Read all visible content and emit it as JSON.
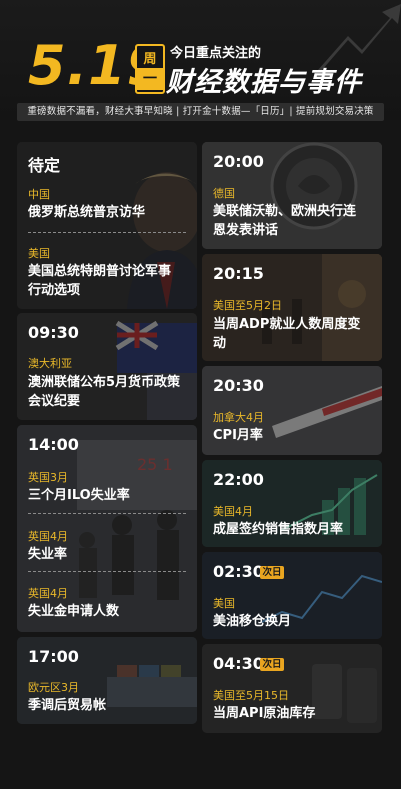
{
  "header": {
    "date": "5.19",
    "weekday_top": "周",
    "weekday_bottom": "一",
    "subtitle": "今日重点关注的",
    "title": "财经数据与事件",
    "tagline": "重磅数据不漏看，财经大事早知晓 | 打开金十数据—「日历」| 提前规划交易决策"
  },
  "left_column": [
    {
      "time": "待定",
      "items": [
        {
          "region": "中国",
          "event": [
            "俄罗斯总统普京访华"
          ]
        },
        {
          "region": "美国",
          "event": [
            "美国总统特朗普讨论军事",
            "行动选项"
          ]
        }
      ]
    },
    {
      "time": "09:30",
      "items": [
        {
          "region": "澳大利亚",
          "event": [
            "澳洲联储公布5月货币政策",
            "会议纪要"
          ]
        }
      ]
    },
    {
      "time": "14:00",
      "items": [
        {
          "region": "英国3月",
          "event": [
            "三个月ILO失业率"
          ]
        },
        {
          "region": "英国4月",
          "event": [
            "失业率"
          ]
        },
        {
          "region": "英国4月",
          "event": [
            "失业金申请人数"
          ]
        }
      ]
    },
    {
      "time": "17:00",
      "items": [
        {
          "region": "欧元区3月",
          "event": [
            "季调后贸易帐"
          ]
        }
      ]
    }
  ],
  "right_column": [
    {
      "time": "20:00",
      "region": "德国",
      "event": [
        "美联储沃勒、欧洲央行连",
        "恩发表讲话"
      ]
    },
    {
      "time": "20:15",
      "region": "美国至5月2日",
      "event": [
        "当周ADP就业人数周度变",
        "动"
      ]
    },
    {
      "time": "20:30",
      "region": "加拿大4月",
      "event": [
        "CPI月率"
      ]
    },
    {
      "time": "22:00",
      "region": "美国4月",
      "event": [
        "成屋签约销售指数月率"
      ]
    },
    {
      "time": "02:30",
      "badge": "次日",
      "region": "美国",
      "event": [
        "美油移仓换月"
      ]
    },
    {
      "time": "04:30",
      "badge": "次日",
      "region": "美国至5月15日",
      "event": [
        "当周API原油库存"
      ]
    }
  ],
  "colors": {
    "accent": "#f3b821",
    "region": "#e9b82a",
    "badge": "#e9a520"
  }
}
